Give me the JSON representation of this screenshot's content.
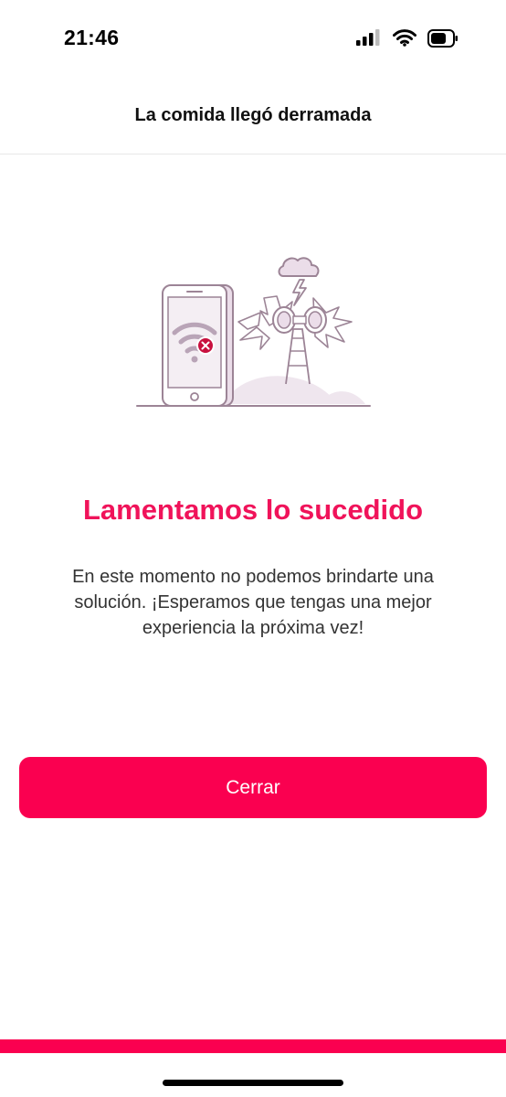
{
  "status_bar": {
    "time": "21:46",
    "icons": [
      "signal-icon",
      "wifi-icon",
      "battery-icon"
    ]
  },
  "header": {
    "title": "La comida llegó derramada"
  },
  "illustration": {
    "icons": [
      "phone-icon",
      "wifi-off-icon",
      "cloud-lightning-icon",
      "antenna-tower-icon"
    ]
  },
  "main": {
    "headline": "Lamentamos lo sucedido",
    "message": "En este momento no podemos brindarte una solución. ¡Esperamos que tengas una mejor experiencia la próxima vez!",
    "button_label": "Cerrar"
  },
  "colors": {
    "accent": "#fa0050",
    "headline": "#f0135a",
    "illustration_stroke": "#9c8496",
    "illustration_fill": "#efe6ee",
    "error_badge": "#c8103e"
  }
}
